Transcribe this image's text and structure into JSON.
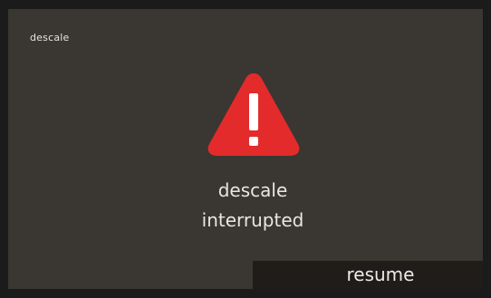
{
  "screen": {
    "title": "descale",
    "icon": "warning-icon",
    "message_line_1": "descale",
    "message_line_2": "interrupted",
    "resume_label": "resume"
  },
  "colors": {
    "background": "#3a3632",
    "warning": "#e32b2b",
    "text": "#e9e7e3",
    "button": "#1f1c1a"
  }
}
